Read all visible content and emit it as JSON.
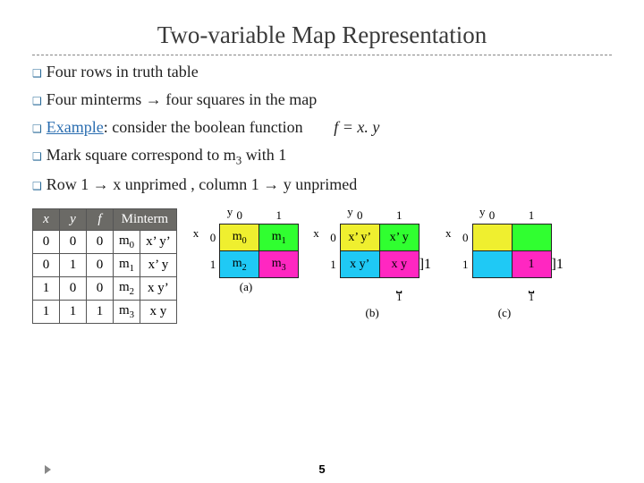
{
  "title": "Two-variable Map Representation",
  "bullets": {
    "b1": "Four rows in truth table",
    "b2": "Four minterms → four squares in the map",
    "b3_label": "Example",
    "b3_text": ": consider the boolean function",
    "b3_eq": "f = x. y",
    "b4_pre": "Mark square correspond to m",
    "b4_sub": "3",
    "b4_post": " with 1",
    "b5": "Row 1 → x unprimed , column 1 → y unprimed"
  },
  "truth": {
    "headers": {
      "x": "x",
      "y": "y",
      "f": "f",
      "minterm": "Minterm"
    },
    "rows": [
      {
        "x": "0",
        "y": "0",
        "f": "0",
        "m": "m",
        "msub": "0",
        "term": "x’ y’"
      },
      {
        "x": "0",
        "y": "1",
        "f": "0",
        "m": "m",
        "msub": "1",
        "term": "x’ y"
      },
      {
        "x": "1",
        "y": "0",
        "f": "0",
        "m": "m",
        "msub": "2",
        "term": "x y’"
      },
      {
        "x": "1",
        "y": "1",
        "f": "1",
        "m": "m",
        "msub": "3",
        "term": "x y"
      }
    ]
  },
  "maps": {
    "xlabel": "x",
    "ylabel": "y",
    "cols": [
      "0",
      "1"
    ],
    "rows": [
      "0",
      "1"
    ],
    "a": {
      "cells": [
        [
          "m",
          "0",
          "yellow"
        ],
        [
          "m",
          "1",
          "green"
        ],
        [
          "m",
          "2",
          "cyan"
        ],
        [
          "m",
          "3",
          "pink"
        ]
      ],
      "caption": "(a)"
    },
    "b": {
      "cells": [
        [
          "x’ y’",
          "",
          "yellow"
        ],
        [
          "x’ y",
          "",
          "green"
        ],
        [
          "x y’",
          "",
          "cyan"
        ],
        [
          "x y",
          "",
          "pink"
        ]
      ],
      "caption": "(b)"
    },
    "c": {
      "cells": [
        [
          "",
          "",
          "yellow"
        ],
        [
          "",
          "",
          "green"
        ],
        [
          "",
          "",
          "cyan"
        ],
        [
          "1",
          "",
          "pink"
        ]
      ],
      "caption": "(c)"
    }
  },
  "page": "5",
  "labels": {
    "bracket1": "1",
    "bracket1_side": "1"
  }
}
